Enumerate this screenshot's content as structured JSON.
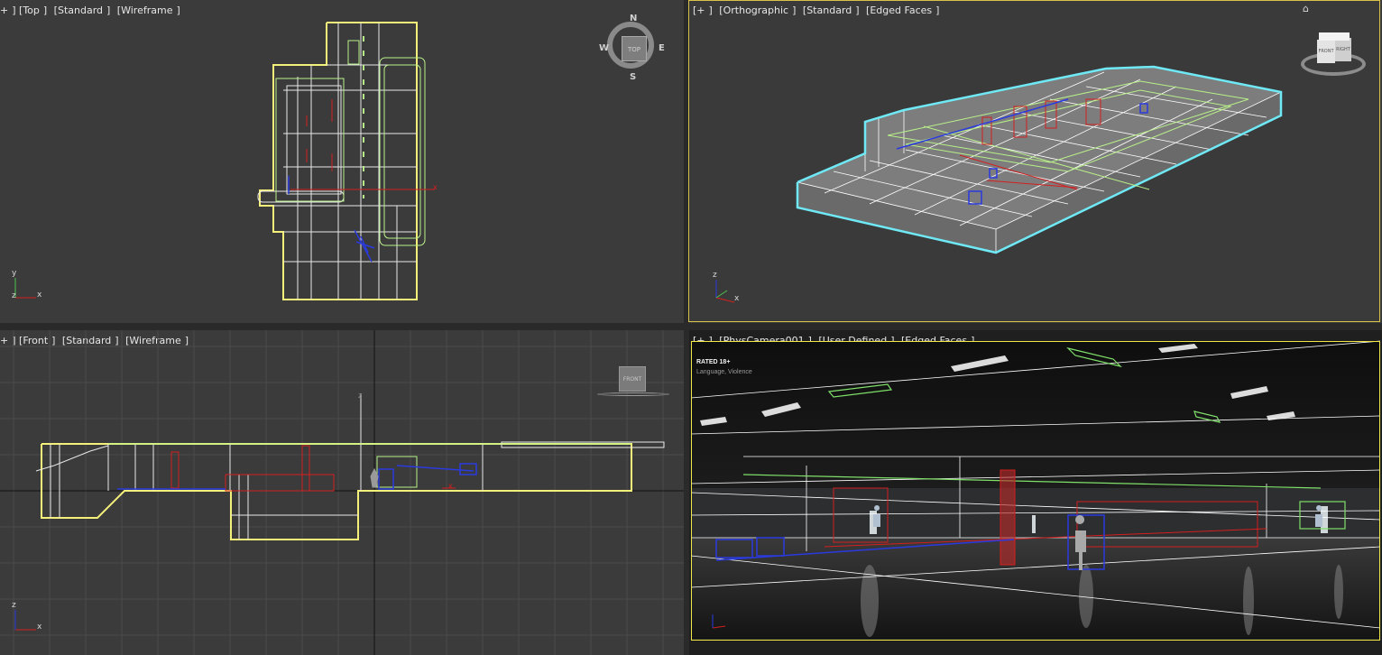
{
  "viewports": {
    "top": {
      "labels": [
        "+",
        "Top",
        "Standard",
        "Wireframe"
      ]
    },
    "ortho": {
      "labels": [
        "+",
        "Orthographic",
        "Standard",
        "Edged Faces"
      ]
    },
    "front": {
      "labels": [
        "+",
        "Front",
        "Standard",
        "Wireframe"
      ]
    },
    "camera": {
      "labels": [
        "+",
        "PhysCamera001",
        "User Defined",
        "Edged Faces"
      ]
    }
  },
  "compass": {
    "n": "N",
    "s": "S",
    "e": "E",
    "w": "W",
    "cube_face": "TOP"
  },
  "viewcube": {
    "front_face": "FRONT",
    "right_face": "RIGHT",
    "front_view_face": "FRONT"
  },
  "axis": {
    "x": "x",
    "y": "y",
    "z": "z"
  },
  "rating": {
    "title": "RATED 18+",
    "descriptor": "Language, Violence"
  },
  "colors": {
    "viewport_bg": "#3a3a3a",
    "selection_yellow": "#f4f07a",
    "wire_white": "#ffffff",
    "wire_green": "#b9f08a",
    "wire_red": "#d41f1f",
    "wire_blue": "#2a3adf",
    "selection_cyan": "#6fe9f5"
  }
}
